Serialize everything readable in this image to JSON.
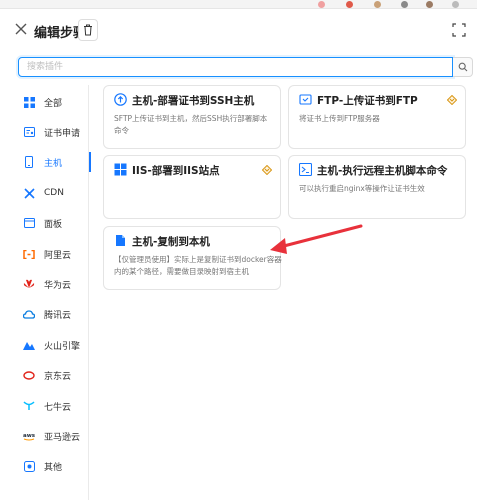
{
  "header": {
    "title": "编辑步骤"
  },
  "search": {
    "placeholder": "搜索插件",
    "value": ""
  },
  "sidebar": {
    "items": [
      {
        "label": "全部",
        "icon": "grid-icon",
        "active": false
      },
      {
        "label": "证书申请",
        "icon": "certificate-icon",
        "active": false
      },
      {
        "label": "主机",
        "icon": "mobile-icon",
        "active": true
      },
      {
        "label": "CDN",
        "icon": "cdn-icon",
        "active": false
      },
      {
        "label": "面板",
        "icon": "panel-icon",
        "active": false
      },
      {
        "label": "阿里云",
        "icon": "aliyun-icon",
        "active": false
      },
      {
        "label": "华为云",
        "icon": "huawei-icon",
        "active": false
      },
      {
        "label": "腾讯云",
        "icon": "tencent-cloud-icon",
        "active": false
      },
      {
        "label": "火山引擎",
        "icon": "volcengine-icon",
        "active": false
      },
      {
        "label": "京东云",
        "icon": "jdcloud-icon",
        "active": false
      },
      {
        "label": "七牛云",
        "icon": "qiniu-icon",
        "active": false
      },
      {
        "label": "亚马逊云",
        "icon": "aws-icon",
        "active": false
      },
      {
        "label": "其他",
        "icon": "other-icon",
        "active": false
      }
    ]
  },
  "cards": [
    {
      "title": "主机-部署证书到SSH主机",
      "desc": "SFTP上传证书到主机，然后SSH执行部署脚本命令",
      "icon": "upload-cloud-icon",
      "pro": false
    },
    {
      "title": "FTP-上传证书到FTP",
      "desc": "将证书上传到FTP服务器",
      "icon": "folder-icon",
      "pro": true
    },
    {
      "title": "IIS-部署到IIS站点",
      "desc": "",
      "icon": "windows-icon",
      "pro": true
    },
    {
      "title": "主机-执行远程主机脚本命令",
      "desc": "可以执行重启nginx等操作让证书生效",
      "icon": "terminal-icon",
      "pro": false
    },
    {
      "title": "主机-复制到本机",
      "desc": "【仅管理员使用】实际上是复制证书到docker容器内的某个路径，需要做目录映射到宿主机",
      "icon": "file-icon",
      "pro": false
    }
  ],
  "colors": {
    "accent": "#1677ff",
    "pro_badge": "#d89614",
    "annotation_arrow": "#e8313b"
  }
}
